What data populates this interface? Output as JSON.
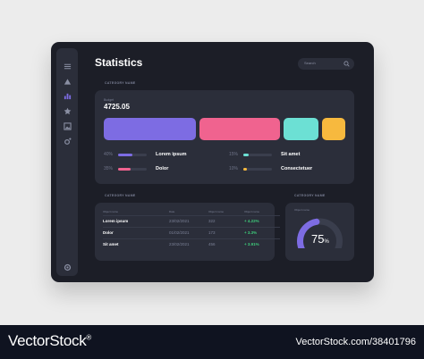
{
  "app": {
    "title": "Statistics"
  },
  "search": {
    "placeholder": "Search"
  },
  "sidebar": {
    "icons": [
      "menu-icon",
      "triangle-icon",
      "bar-chart-icon",
      "star-icon",
      "image-icon",
      "refresh-gear-icon"
    ],
    "active": "bar-chart-icon",
    "bottom_icon": "settings-icon"
  },
  "overview": {
    "section_label": "CATEGORY NAME",
    "budget_label": "Budget",
    "budget_value": "4725.05",
    "segments": [
      {
        "share": 0.4,
        "color": "#7d6ce3"
      },
      {
        "share": 0.35,
        "color": "#f0638f"
      },
      {
        "share": 0.15,
        "color": "#6ce0d4"
      },
      {
        "share": 0.1,
        "color": "#f7b93e"
      }
    ],
    "legend": [
      {
        "pct": "40%",
        "label": "Lorem ipsum",
        "fill": 0.4,
        "color": "#7d6ce3"
      },
      {
        "pct": "35%",
        "label": "Dolor",
        "fill": 0.35,
        "color": "#f0638f"
      },
      {
        "pct": "15%",
        "label": "Sit amet",
        "fill": 0.15,
        "color": "#6ce0d4"
      },
      {
        "pct": "10%",
        "label": "Consectetuer",
        "fill": 0.1,
        "color": "#f7b93e"
      }
    ]
  },
  "table": {
    "section_label": "CATEGORY NAME",
    "headers": [
      "Object name",
      "Date",
      "Object name",
      "Object name"
    ],
    "rows": [
      {
        "name": "Lorem ipsum",
        "date": "23/02/2021",
        "value": "322",
        "change": "+ 4.22%"
      },
      {
        "name": "Dolor",
        "date": "01/02/2021",
        "value": "173",
        "change": "+ 3.3%"
      },
      {
        "name": "Sit amet",
        "date": "23/02/2021",
        "value": "456",
        "change": "+ 3.91%"
      }
    ]
  },
  "gauge": {
    "section_label": "CATEGORY NAME",
    "label": "Object name",
    "value": "75",
    "unit": "%",
    "fraction": 0.75,
    "color": "#7d6ce3"
  },
  "footer": {
    "brand": "VectorStock",
    "reg": "®",
    "id": "VectorStock.com/38401796"
  }
}
